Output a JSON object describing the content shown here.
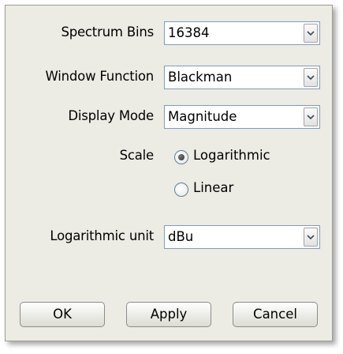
{
  "fields": {
    "spectrum_bins": {
      "label": "Spectrum Bins",
      "value": "16384"
    },
    "window_function": {
      "label": "Window Function",
      "value": "Blackman"
    },
    "display_mode": {
      "label": "Display Mode",
      "value": "Magnitude"
    },
    "scale": {
      "label": "Scale",
      "options": [
        {
          "label": "Logarithmic",
          "selected": true
        },
        {
          "label": "Linear",
          "selected": false
        }
      ]
    },
    "logarithmic_unit": {
      "label": "Logarithmic unit",
      "value": "dBu"
    }
  },
  "buttons": {
    "ok": "OK",
    "apply": "Apply",
    "cancel": "Cancel"
  },
  "icons": {
    "dropdown": "chevron-down-icon",
    "radio": "radio-button"
  }
}
